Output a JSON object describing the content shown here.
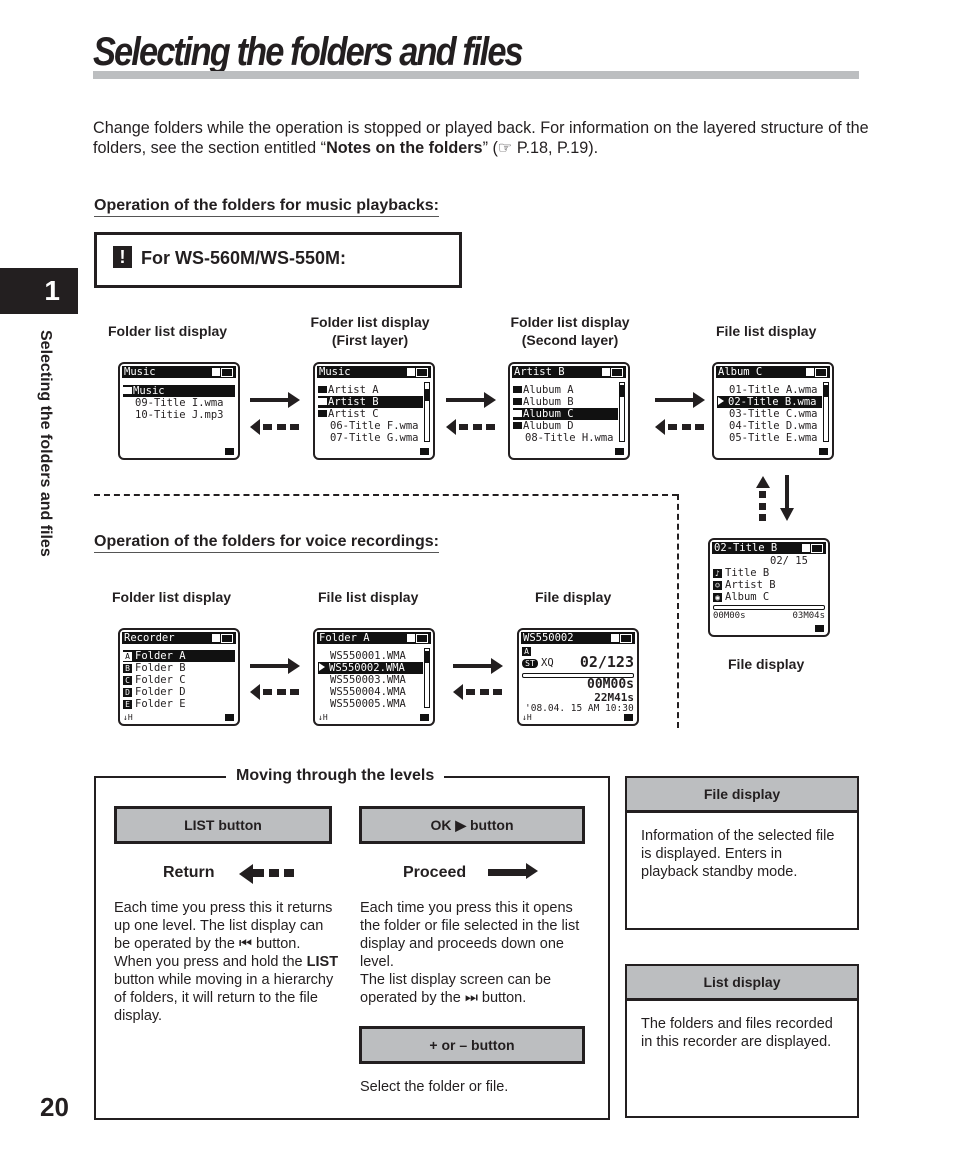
{
  "page": {
    "title": "Selecting the folders and files",
    "intro_plain": "Change folders while the operation is stopped or played back. For information on the layered structure of the folders, see the section entitled “",
    "intro_bold": "Notes on the folders",
    "intro_ref": "” (☞ P.18, P.19).",
    "chapter_number": "1",
    "side_label": "Selecting the folders and files",
    "page_number": "20"
  },
  "music": {
    "heading": "Operation of the folders for music playbacks:",
    "model_icon": "warning-icon",
    "model_icon_glyph": "!",
    "model_label": "For WS-560M/WS-550M:",
    "captions": [
      {
        "line1": "Folder list display",
        "line2": ""
      },
      {
        "line1": "Folder list display",
        "line2": "(First layer)"
      },
      {
        "line1": "Folder list display",
        "line2": "(Second layer)"
      },
      {
        "line1": "File list display",
        "line2": ""
      }
    ],
    "screens": [
      {
        "header": "Music",
        "rows": [
          {
            "text": "Music",
            "type": "folder",
            "selected": true
          },
          {
            "text": "09-Title I.wma",
            "type": "file",
            "selected": false
          },
          {
            "text": "10-Titie J.mp3",
            "type": "file",
            "selected": false
          }
        ]
      },
      {
        "header": "Music",
        "rows": [
          {
            "text": "Artist A",
            "type": "folder",
            "selected": false
          },
          {
            "text": "Artist B",
            "type": "folder",
            "selected": true
          },
          {
            "text": "Artist C",
            "type": "folder",
            "selected": false
          },
          {
            "text": "06-Title F.wma",
            "type": "file",
            "selected": false
          },
          {
            "text": "07-Title G.wma",
            "type": "file",
            "selected": false
          }
        ]
      },
      {
        "header": "Artist B",
        "rows": [
          {
            "text": "Alubum A",
            "type": "folder",
            "selected": false
          },
          {
            "text": "Alubum B",
            "type": "folder",
            "selected": false
          },
          {
            "text": "Alubum C",
            "type": "folder",
            "selected": true
          },
          {
            "text": "Alubum D",
            "type": "folder",
            "selected": false
          },
          {
            "text": "08-Title H.wma",
            "type": "file",
            "selected": false
          }
        ]
      },
      {
        "header": "Album C",
        "rows": [
          {
            "text": "01-Title A.wma",
            "type": "file",
            "selected": false
          },
          {
            "text": "02-Title B.wma",
            "type": "play",
            "selected": true
          },
          {
            "text": "03-Title C.wma",
            "type": "file",
            "selected": false
          },
          {
            "text": "04-Title D.wma",
            "type": "file",
            "selected": false
          },
          {
            "text": "05-Title E.wma",
            "type": "file",
            "selected": false
          }
        ]
      }
    ],
    "file_display": {
      "caption": "File display",
      "header": "02-Title B",
      "track": "02/ 15",
      "title": "Title B",
      "artist": "Artist B",
      "album": "Album C",
      "elapsed": "00M00s",
      "total": "03M04s"
    }
  },
  "voice": {
    "heading": "Operation of the folders for voice recordings:",
    "captions": [
      "Folder list display",
      "File list display",
      "File display"
    ],
    "screens": [
      {
        "header": "Recorder",
        "rows": [
          {
            "letter": "A",
            "text": "Folder A",
            "selected": true
          },
          {
            "letter": "B",
            "text": "Folder B",
            "selected": false
          },
          {
            "letter": "C",
            "text": "Folder C",
            "selected": false
          },
          {
            "letter": "D",
            "text": "Folder D",
            "selected": false
          },
          {
            "letter": "E",
            "text": "Folder E",
            "selected": false
          }
        ],
        "mic": "↓H"
      },
      {
        "header": "Folder A",
        "rows": [
          {
            "text": "WS550001.WMA",
            "type": "file",
            "selected": false
          },
          {
            "text": "WS550002.WMA",
            "type": "play",
            "selected": true
          },
          {
            "text": "WS550003.WMA",
            "type": "file",
            "selected": false
          },
          {
            "text": "WS550004.WMA",
            "type": "file",
            "selected": false
          },
          {
            "text": "WS550005.WMA",
            "type": "file",
            "selected": false
          }
        ],
        "mic": "↓H"
      },
      {
        "header": "WS550002",
        "folder_letter": "A",
        "mode": "ST",
        "quality": "XQ",
        "file_pos": "02/123",
        "elapsed": "00M00s",
        "remaining": "22M41s",
        "date": "'08.04. 15 AM 10:30",
        "mic": "↓H"
      }
    ]
  },
  "levels": {
    "title": "Moving through the levels",
    "list_button": "LIST button",
    "ok_button": "OK ▶ button",
    "return_label": "Return",
    "proceed_label": "Proceed",
    "return_text_1": "Each time you press this it returns up one level. The list display can be operated by the",
    "return_text_glyph": "⏮",
    "return_text_2": " button.",
    "return_text_3": "When you press and hold the ",
    "return_text_bold": "LIST",
    "return_text_4": " button while moving in a hierarchy of folders, it will return to the file display.",
    "proceed_text_1": "Each time you press this it opens the folder or file selected in the list display and proceeds down one level.",
    "proceed_text_2": "The list display screen can be operated by the ",
    "proceed_text_glyph": "⏭",
    "proceed_text_3": " button.",
    "plus_minus_button": "+ or – button",
    "plus_minus_text": "Select the folder or file."
  },
  "side_boxes": [
    {
      "title": "File display",
      "text": "Information of the selected file is displayed. Enters in playback standby mode."
    },
    {
      "title": "List display",
      "text": "The folders and files recorded in this recorder are displayed."
    }
  ]
}
